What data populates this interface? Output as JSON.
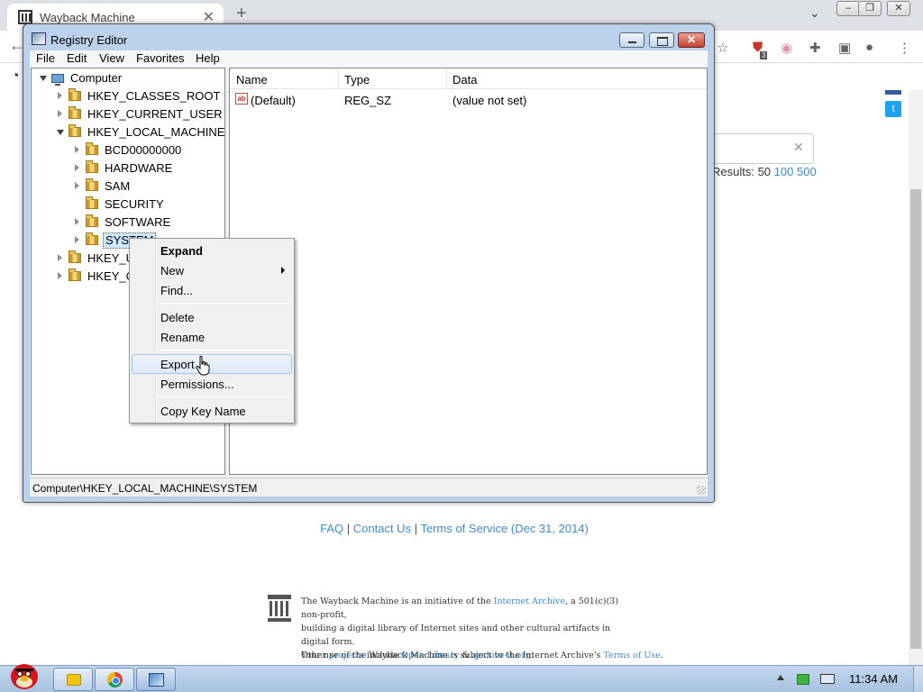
{
  "browser": {
    "tab_title": "Wayback Machine",
    "tab_close": "✕",
    "new_tab": "+",
    "tab_dropdown": "⌄",
    "extension_badge": "3",
    "search_clear": "✕",
    "results_prefix": "Results: 50",
    "results_100": "100",
    "results_500": "500"
  },
  "footer": {
    "faq": "FAQ",
    "sep1": " | ",
    "contact": "Contact Us",
    "sep2": " | ",
    "tos": "Terms of Service (Dec 31, 2014)",
    "ia_line1_a": "The Wayback Machine is an initiative of the ",
    "ia_line1_link": "Internet Archive",
    "ia_line1_b": ", a 501(c)(3) non-profit,",
    "ia_line2": "building a digital library of Internet sites and other cultural artifacts in digital form.",
    "ia_line3_a": "Other ",
    "ia_line3_projects": "projects",
    "ia_line3_b": " include ",
    "ia_line3_openlib": "Open Library",
    "ia_line3_c": " & ",
    "ia_line3_archiveit": "archive-it.org",
    "ia_line3_d": ".",
    "use_a": "Your use of the Wayback Machine is subject to the Internet Archive's ",
    "use_link": "Terms of Use",
    "use_b": "."
  },
  "regedit": {
    "title": "Registry Editor",
    "close_glyph": "✕",
    "menu": [
      "File",
      "Edit",
      "View",
      "Favorites",
      "Help"
    ],
    "tree": {
      "root": "Computer",
      "hkcr": "HKEY_CLASSES_ROOT",
      "hkcu": "HKEY_CURRENT_USER",
      "hklm": "HKEY_LOCAL_MACHINE",
      "hklm_children": [
        "BCD00000000",
        "HARDWARE",
        "SAM",
        "SECURITY",
        "SOFTWARE",
        "SYSTEM"
      ],
      "hku": "HKEY_U",
      "hkcc": "HKEY_CU"
    },
    "columns": {
      "name": "Name",
      "type": "Type",
      "data": "Data"
    },
    "values": [
      {
        "name": "(Default)",
        "type": "REG_SZ",
        "data": "(value not set)",
        "icon": "ab"
      }
    ],
    "status": "Computer\\HKEY_LOCAL_MACHINE\\SYSTEM"
  },
  "context_menu": {
    "items": [
      "Expand",
      "New",
      "Find...",
      "Delete",
      "Rename",
      "Export",
      "Permissions...",
      "Copy Key Name"
    ],
    "hovered": "Export",
    "default_item": "Expand"
  },
  "taskbar": {
    "clock": "11:34 AM"
  }
}
